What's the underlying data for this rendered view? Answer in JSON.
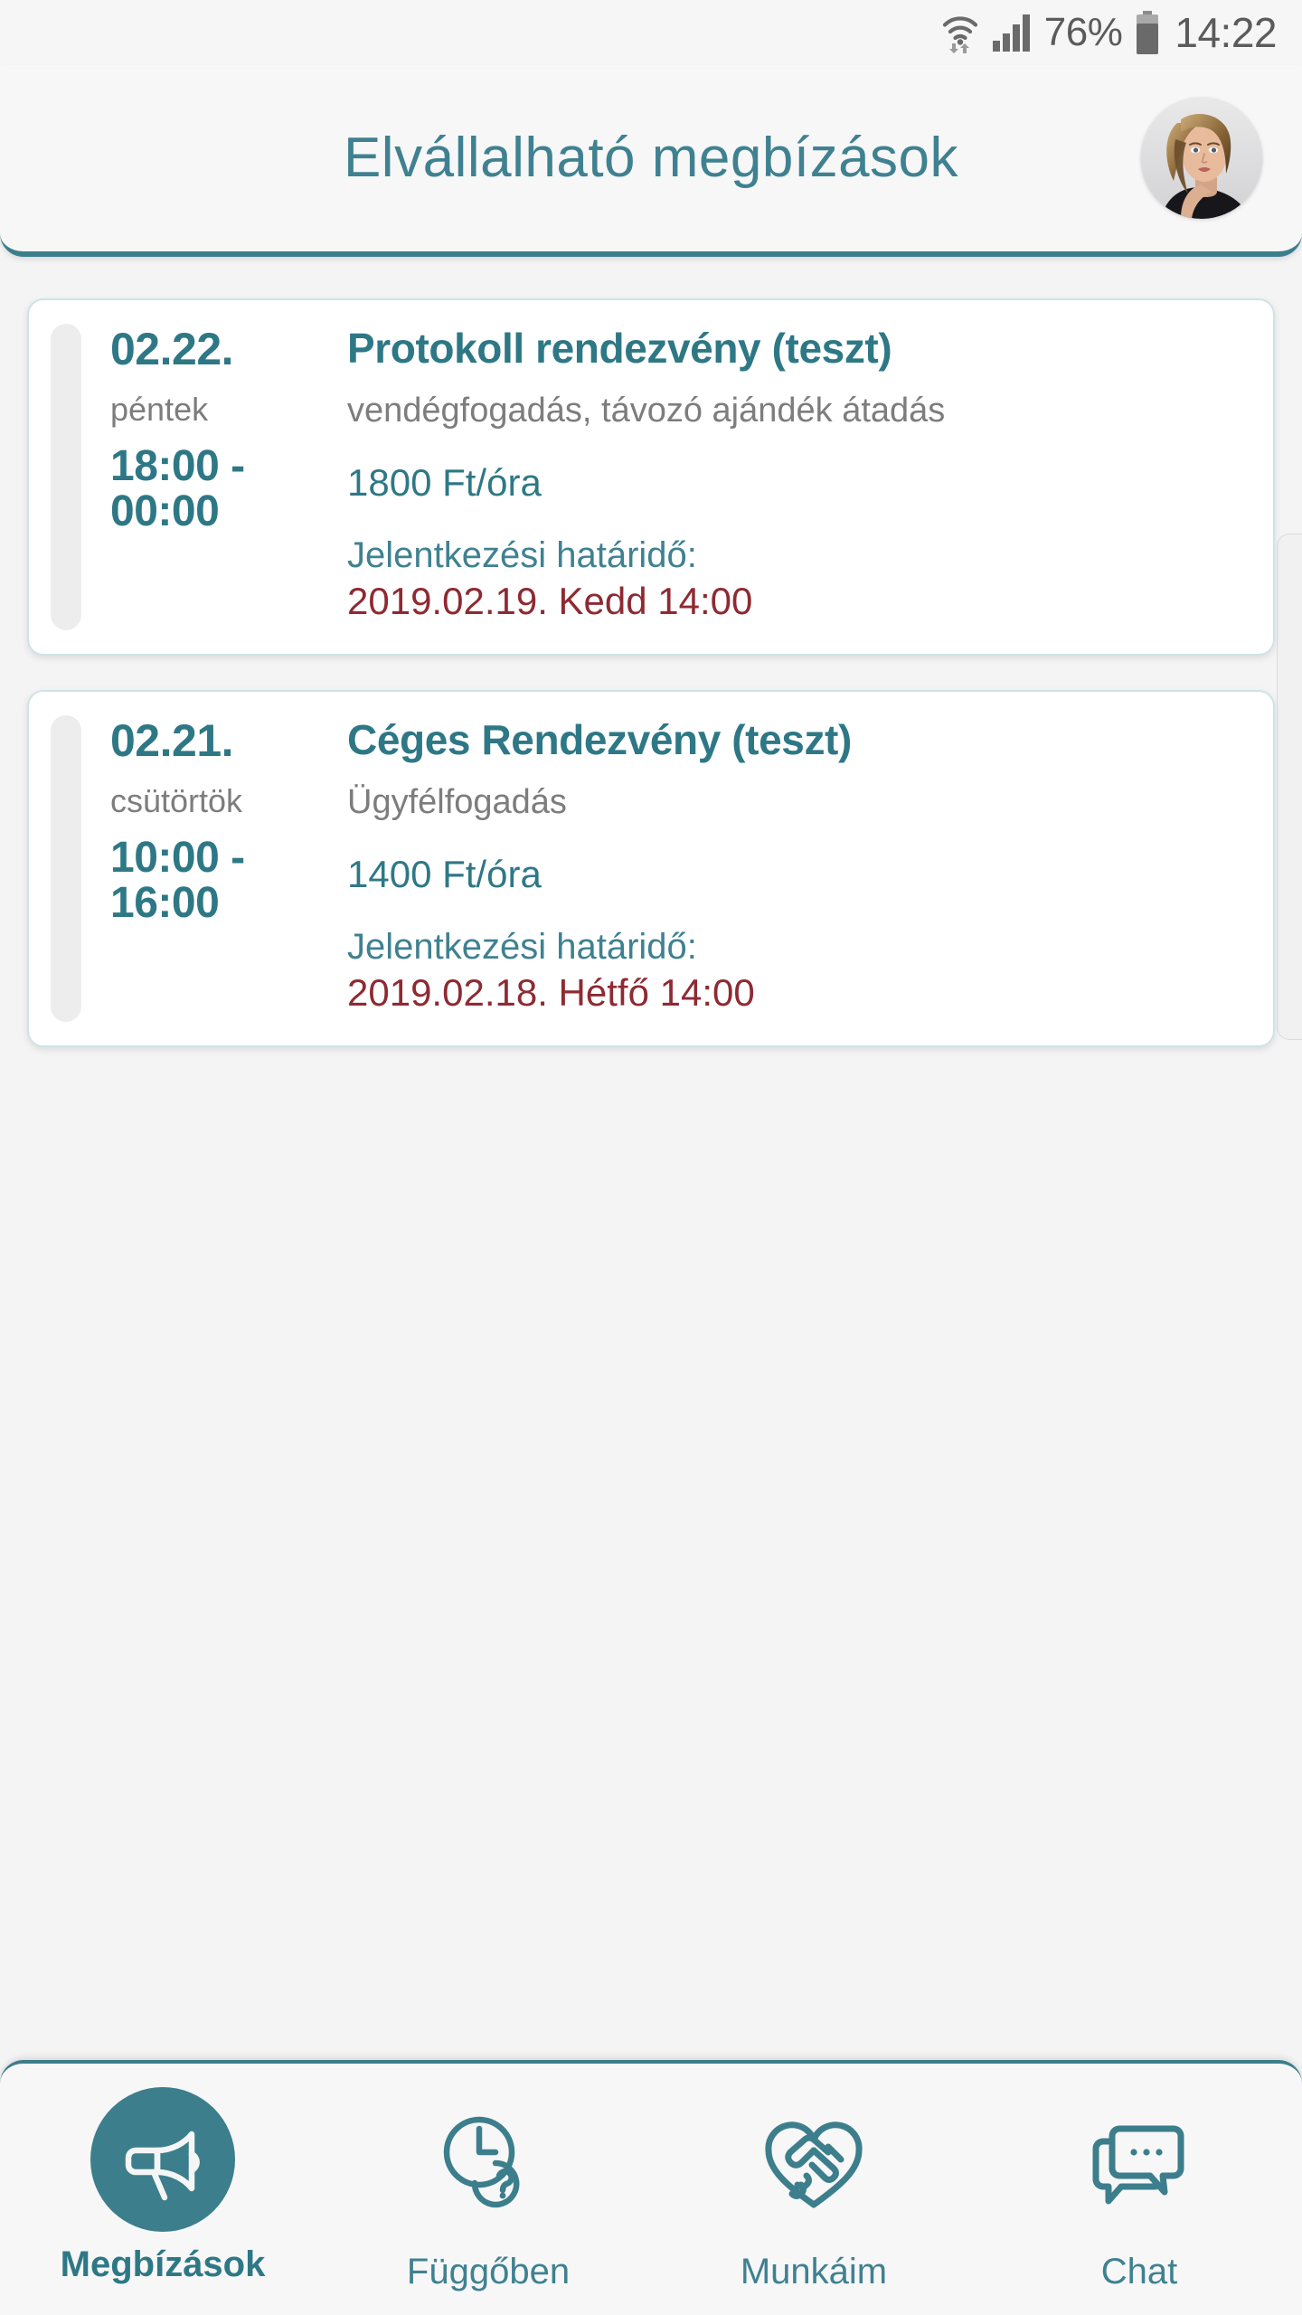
{
  "statusbar": {
    "wifi_icon": "wifi-icon",
    "signal_icon": "signal-bars-icon",
    "battery_percent": "76%",
    "battery_icon": "battery-icon",
    "clock": "14:22"
  },
  "header": {
    "title": "Elvállalható megbízások",
    "avatar_icon": "user-avatar-photo"
  },
  "jobs": [
    {
      "date": "02.22.",
      "weekday": "péntek",
      "time_range": "18:00 - 00:00",
      "title": "Protokoll rendezvény (teszt)",
      "description": "vendégfogadás, távozó ajándék átadás",
      "rate": "1800 Ft/óra",
      "deadline_label": "Jelentkezési határidő:",
      "deadline_value": "2019.02.19. Kedd 14:00"
    },
    {
      "date": "02.21.",
      "weekday": "csütörtök",
      "time_range": "10:00 - 16:00",
      "title": "Céges Rendezvény (teszt)",
      "description": "Ügyfélfogadás",
      "rate": "1400 Ft/óra",
      "deadline_label": "Jelentkezési határidő:",
      "deadline_value": "2019.02.18. Hétfő 14:00"
    }
  ],
  "bottomnav": {
    "items": [
      {
        "label": "Megbízások",
        "icon": "megaphone-icon",
        "active": true
      },
      {
        "label": "Függőben",
        "icon": "clock-question-icon",
        "active": false
      },
      {
        "label": "Munkáim",
        "icon": "handshake-heart-icon",
        "active": false
      },
      {
        "label": "Chat",
        "icon": "chat-bubbles-icon",
        "active": false
      }
    ]
  },
  "colors": {
    "accent_teal": "#3c7e8c",
    "title_teal": "#2e7886",
    "deadline_red": "#8e2a32",
    "muted_gray": "#7d7d7d",
    "page_bg": "#f4f4f4",
    "card_bg": "#ffffff"
  }
}
